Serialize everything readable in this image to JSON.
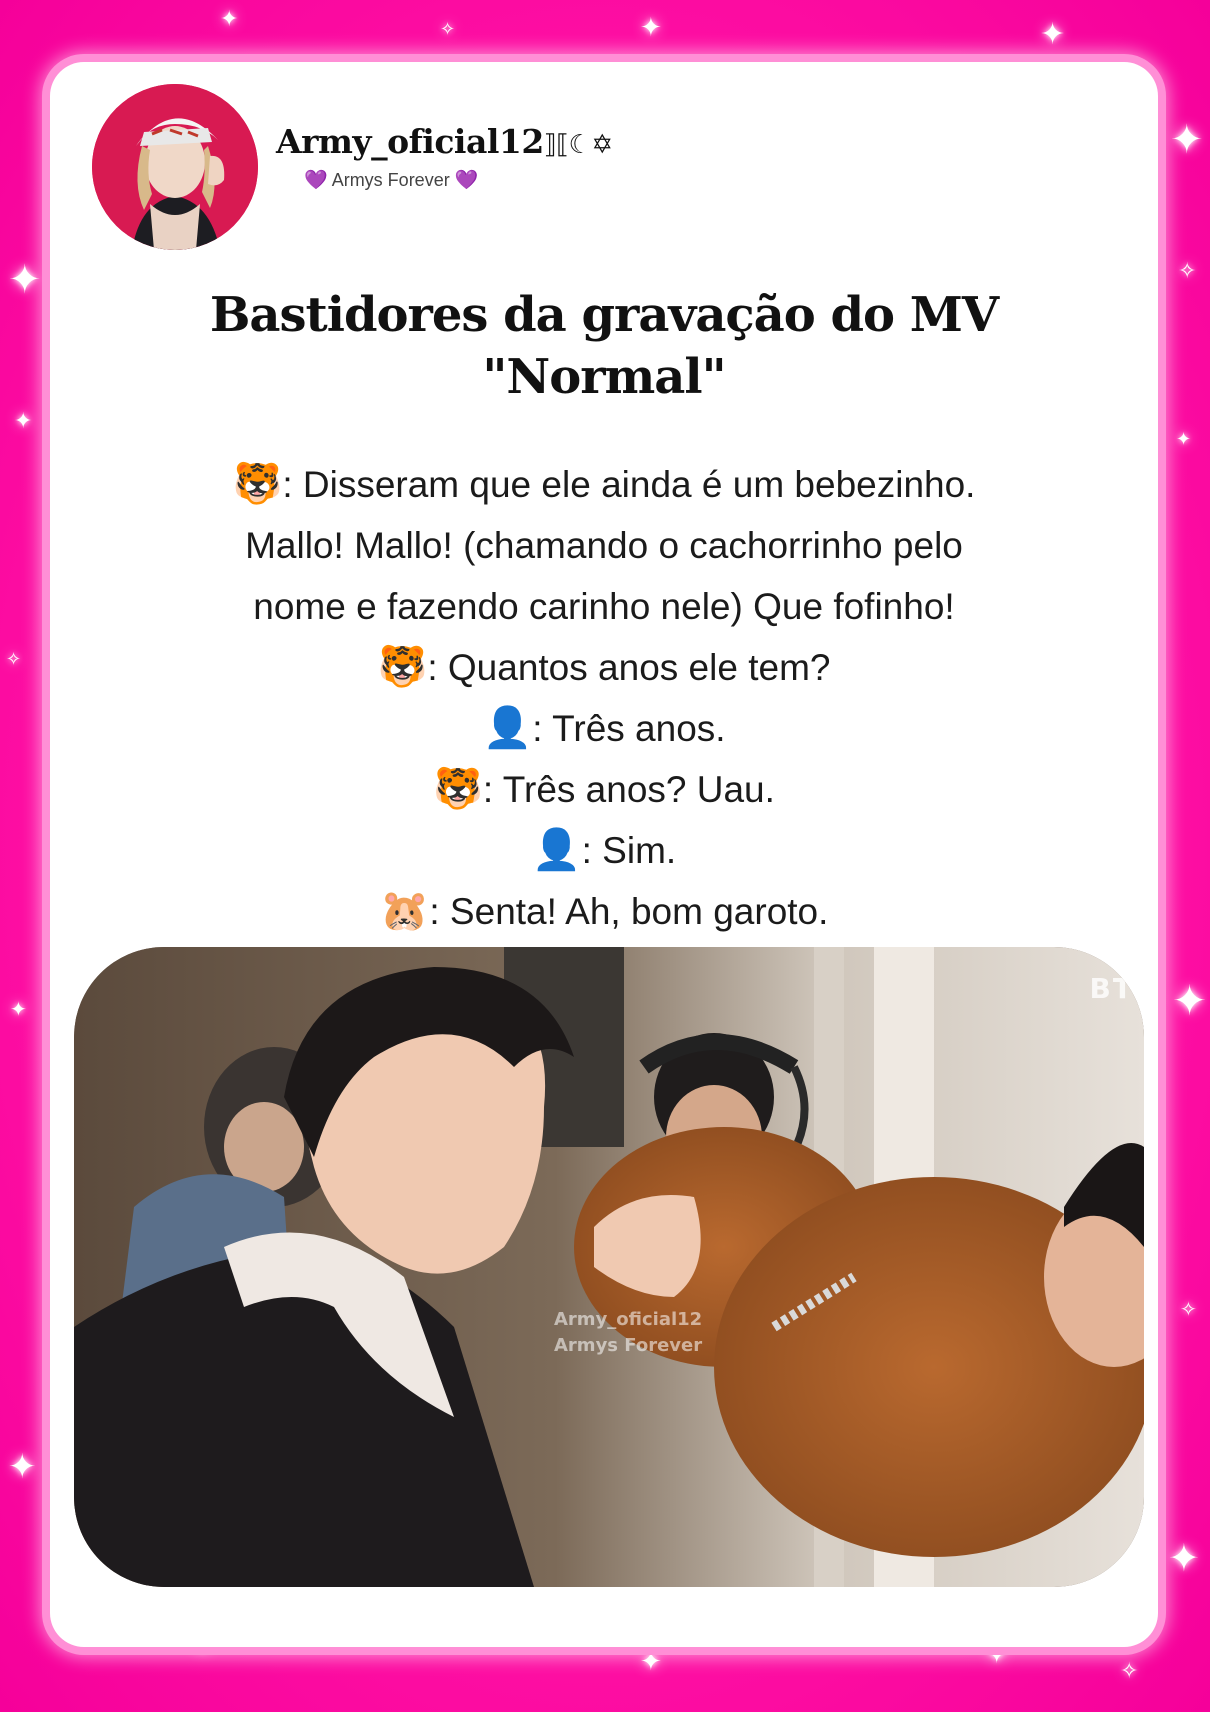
{
  "profile": {
    "username": "Army_oficial12",
    "username_symbols": "⟧⟦☾✡",
    "subtitle_text": "Armys Forever",
    "subtitle_heart": "💜"
  },
  "post": {
    "title_line1": "Bastidores da gravação do MV",
    "title_line2": "\"Normal\"",
    "dialogue": [
      {
        "icon": "🐯",
        "text": ": Disseram que ele ainda é um bebezinho."
      },
      {
        "icon": "",
        "text": "Mallo! Mallo! (chamando o cachorrinho pelo"
      },
      {
        "icon": "",
        "text": "nome e fazendo carinho nele) Que fofinho!"
      },
      {
        "icon": "🐯",
        "text": ": Quantos anos ele tem?"
      },
      {
        "icon": "👤",
        "text": ": Três anos."
      },
      {
        "icon": "🐯",
        "text": ": Três anos? Uau."
      },
      {
        "icon": "👤",
        "text": ": Sim."
      },
      {
        "icon": "🐹",
        "text": ": Senta! Ah, bom garoto."
      }
    ]
  },
  "photo": {
    "watermark_line1": "Army_oficial12",
    "watermark_line2": "Armys Forever",
    "corner_text": "BT"
  },
  "colors": {
    "background": "#ff11a4",
    "card": "#ffffff",
    "text": "#111111"
  }
}
